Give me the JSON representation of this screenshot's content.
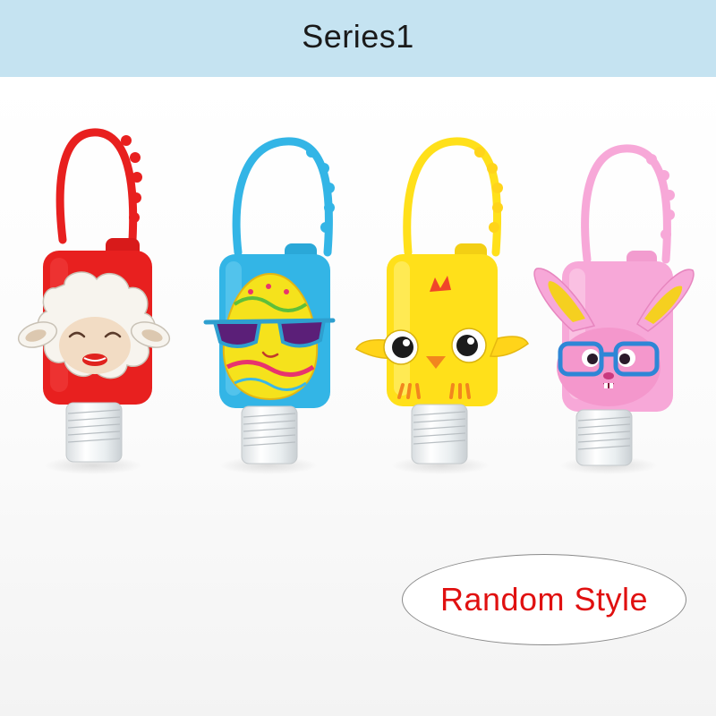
{
  "banner": {
    "title": "Series1",
    "background": "#c5e3f1"
  },
  "badge": {
    "text": "Random Style",
    "text_color": "#e01010"
  },
  "products": [
    {
      "character": "sheep",
      "color": "#e8201f"
    },
    {
      "character": "easter-egg-with-sunglasses",
      "color": "#33b5e6"
    },
    {
      "character": "chick",
      "color": "#ffe01a"
    },
    {
      "character": "bunny-with-glasses",
      "color": "#f7a8d8"
    }
  ]
}
